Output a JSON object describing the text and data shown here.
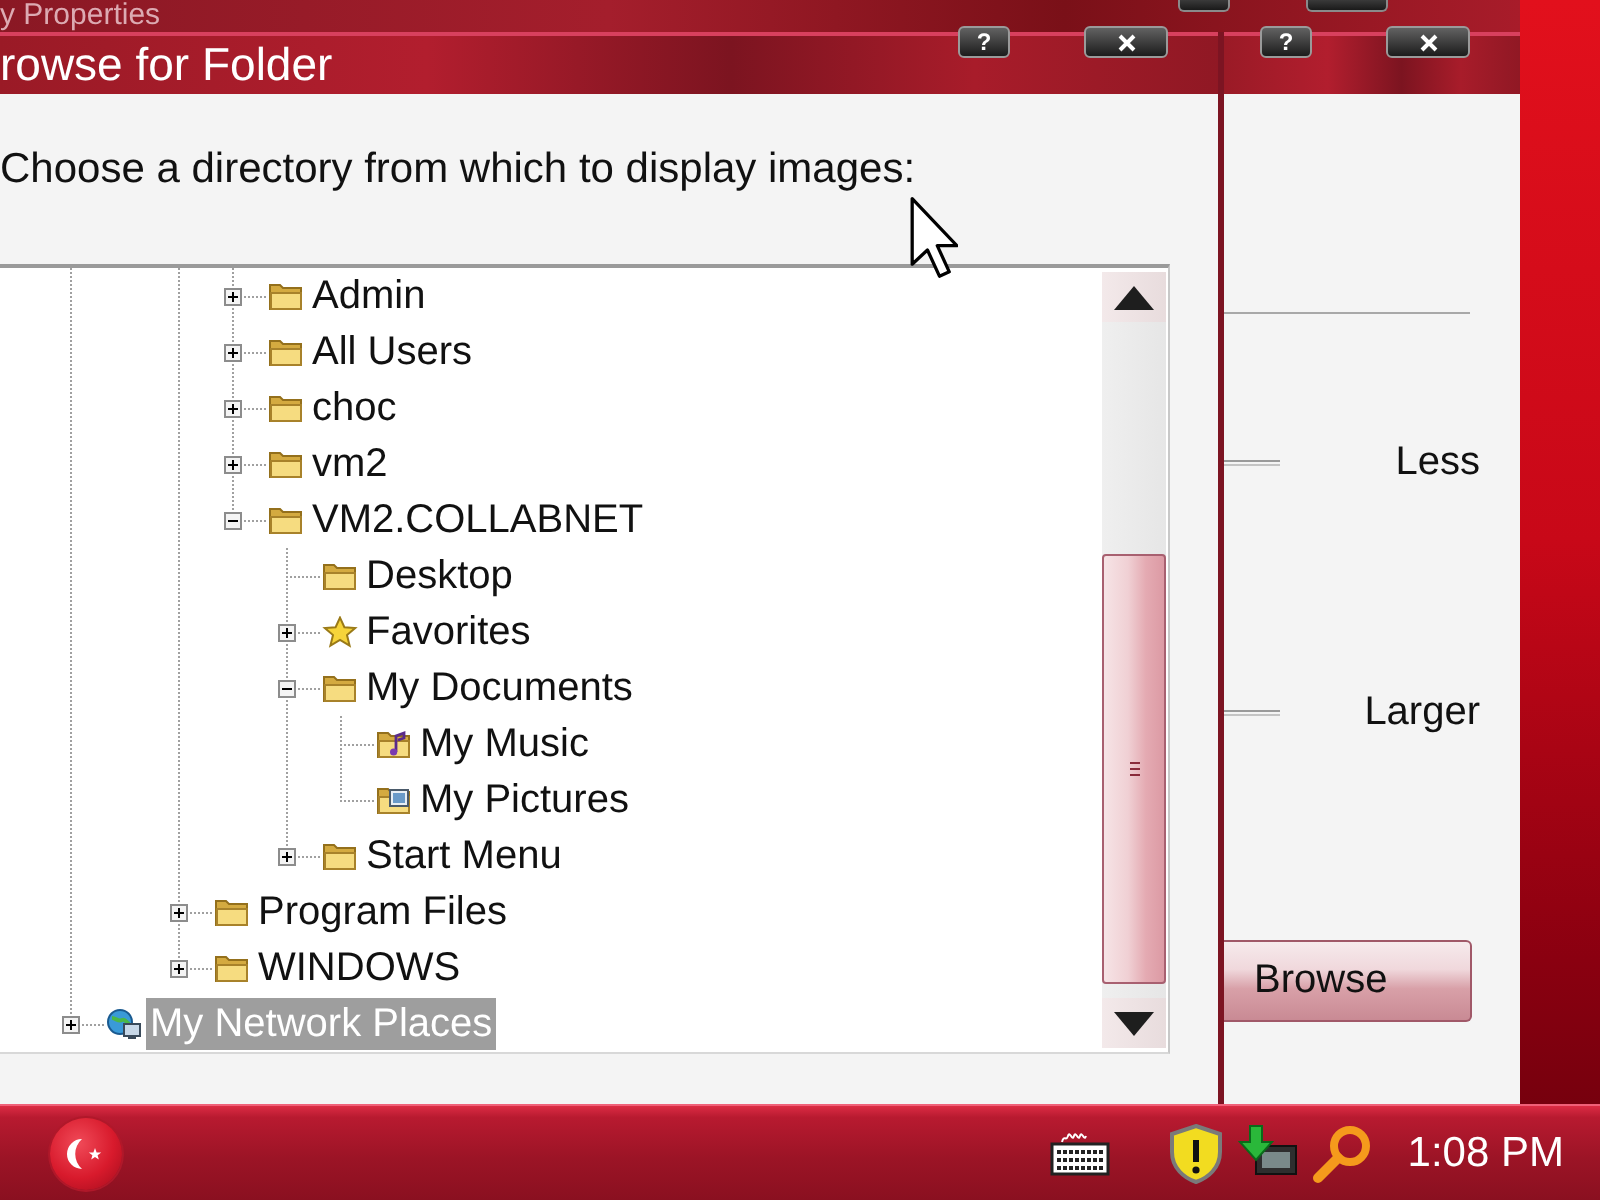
{
  "back_window": {
    "title": "y Properties"
  },
  "properties_window": {
    "title_buttons": [
      {
        "kind": "help",
        "label": "?"
      },
      {
        "kind": "close"
      }
    ],
    "labels": [
      "Less",
      "Larger"
    ],
    "browse_button": "Browse"
  },
  "dialog": {
    "title": "rowse for Folder",
    "title_buttons": [
      {
        "kind": "help",
        "label": "?"
      },
      {
        "kind": "close"
      }
    ],
    "prompt": "Choose a directory from which to display images:",
    "tree": {
      "items": [
        {
          "children": [
            {
              "children": [
                {
                  "children": [
                    {
                      "label": "Admin",
                      "kind": "folder",
                      "expanded": false,
                      "selected": false
                    },
                    {
                      "label": "All Users",
                      "kind": "folder",
                      "expanded": false,
                      "selected": false
                    },
                    {
                      "label": "choc",
                      "kind": "folder",
                      "expanded": false,
                      "selected": false
                    },
                    {
                      "label": "vm2",
                      "kind": "folder",
                      "expanded": false,
                      "selected": false
                    },
                    {
                      "label": "VM2.COLLABNET",
                      "kind": "folder",
                      "expanded": true,
                      "selected": false,
                      "children": [
                        {
                          "label": "Desktop",
                          "kind": "folder",
                          "selected": false
                        },
                        {
                          "label": "Favorites",
                          "kind": "favorites",
                          "expanded": false,
                          "selected": false
                        },
                        {
                          "label": "My Documents",
                          "kind": "folder",
                          "expanded": true,
                          "selected": false,
                          "children": [
                            {
                              "label": "My Music",
                              "kind": "music",
                              "selected": false
                            },
                            {
                              "label": "My Pictures",
                              "kind": "pictures",
                              "selected": false
                            }
                          ]
                        },
                        {
                          "label": "Start Menu",
                          "kind": "folder",
                          "expanded": false,
                          "selected": false
                        }
                      ]
                    }
                  ]
                },
                {
                  "label": "Program Files",
                  "kind": "folder",
                  "expanded": false,
                  "selected": false
                },
                {
                  "label": "WINDOWS",
                  "kind": "folder",
                  "expanded": false,
                  "selected": false
                }
              ]
            }
          ]
        },
        {
          "label": "My Network Places",
          "kind": "network",
          "expanded": false,
          "selected": true
        }
      ]
    }
  },
  "taskbar": {
    "clock": "1:08 PM"
  }
}
